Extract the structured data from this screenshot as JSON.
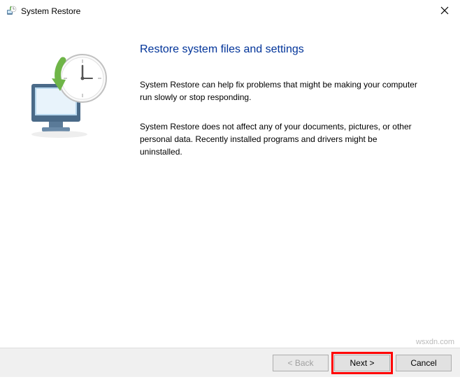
{
  "window": {
    "title": "System Restore",
    "icon_name": "system-restore-icon"
  },
  "page": {
    "heading": "Restore system files and settings",
    "paragraph1": "System Restore can help fix problems that might be making your computer run slowly or stop responding.",
    "paragraph2": "System Restore does not affect any of your documents, pictures, or other personal data. Recently installed programs and drivers might be uninstalled."
  },
  "buttons": {
    "back": "< Back",
    "next": "Next >",
    "cancel": "Cancel"
  },
  "watermark": "wsxdn.com"
}
